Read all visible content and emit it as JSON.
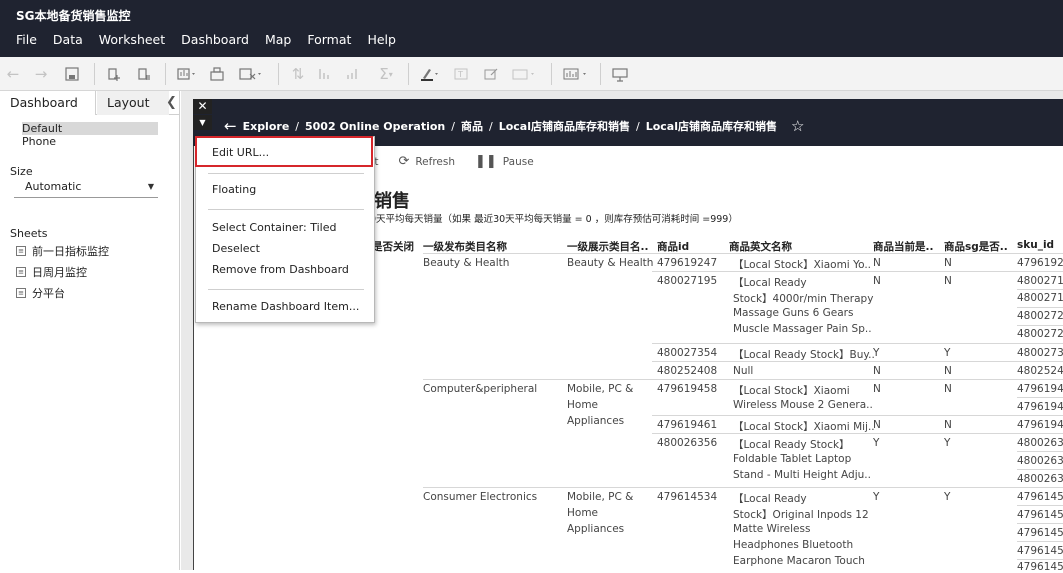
{
  "app": {
    "title": "SG本地备货销售监控"
  },
  "menu": [
    "File",
    "Data",
    "Worksheet",
    "Dashboard",
    "Map",
    "Format",
    "Help"
  ],
  "left_panel": {
    "tabs": [
      "Dashboard",
      "Layout"
    ],
    "devices": [
      "Default",
      "Phone"
    ],
    "size_label": "Size",
    "size_value": "Automatic",
    "sheets_label": "Sheets",
    "sheets": [
      "前一日指标监控",
      "日周月监控",
      "分平台"
    ]
  },
  "embedded": {
    "breadcrumb": [
      "Explore",
      "5002 Online Operation",
      "商品",
      "Local店铺商品库存和销售",
      "Local店铺商品库存和销售"
    ],
    "toolbar": [
      "rt",
      "Refresh",
      "Pause"
    ],
    "heading": "销售",
    "subheading": "0天平均每天销量（如果 最近30天平均每天销量 = 0 ，则库存预估可消耗时间 =999）",
    "table": {
      "headers": [
        "是否关闭",
        "一级发布类目名称",
        "一级展示类目名..",
        "商品id",
        "商品英文名称",
        "商品当前是..",
        "商品sg是否..",
        "sku_id"
      ],
      "rows": [
        [
          "Beauty & Health",
          "Beauty & Health",
          "479619247",
          "【Local Stock】Xiaomi Yo..",
          "N",
          "N",
          "4796192"
        ],
        [
          "480027195",
          "【Local Ready",
          "Stock】4000r/min Therapy",
          "Massage Guns 6 Gears",
          "Muscle Massager Pain Sp..",
          "N",
          "N",
          "4800271",
          "4800271",
          "4800272",
          "4800272"
        ],
        [
          "480027354",
          "【Local Ready Stock】Buy..",
          "Y",
          "Y",
          "4800273"
        ],
        [
          "480252408",
          "Null",
          "N",
          "N",
          "4802524"
        ],
        [
          "Computer&peripheral",
          "Mobile, PC &",
          "Home",
          "Appliances",
          "479619458",
          "【Local Stock】Xiaomi",
          "Wireless Mouse 2 Genera..",
          "N",
          "N",
          "4796194",
          "4796194"
        ],
        [
          "479619461",
          "【Local Stock】Xiaomi Mij..",
          "N",
          "N",
          "4796194"
        ],
        [
          "480026356",
          "【Local Ready Stock】",
          "Foldable Tablet Laptop",
          "Stand - Multi Height Adju..",
          "Y",
          "Y",
          "4800263",
          "4800263",
          "4800263"
        ],
        [
          "Consumer Electronics",
          "Mobile, PC &",
          "Home",
          "Appliances",
          "479614534",
          "【Local Ready",
          "Stock】Original Inpods 12",
          "Matte Wireless",
          "Headphones Bluetooth",
          "Earphone Macaron Touch",
          "Y",
          "Y",
          "4796145",
          "4796145",
          "4796145",
          "4796145",
          "4796145"
        ]
      ]
    }
  },
  "context_menu": [
    "Edit URL...",
    "Floating",
    "Select Container: Tiled",
    "Deselect",
    "Remove from Dashboard",
    "Rename Dashboard Item..."
  ],
  "colors": {
    "dark": "#1f2330",
    "highlight": "#d6262b"
  }
}
